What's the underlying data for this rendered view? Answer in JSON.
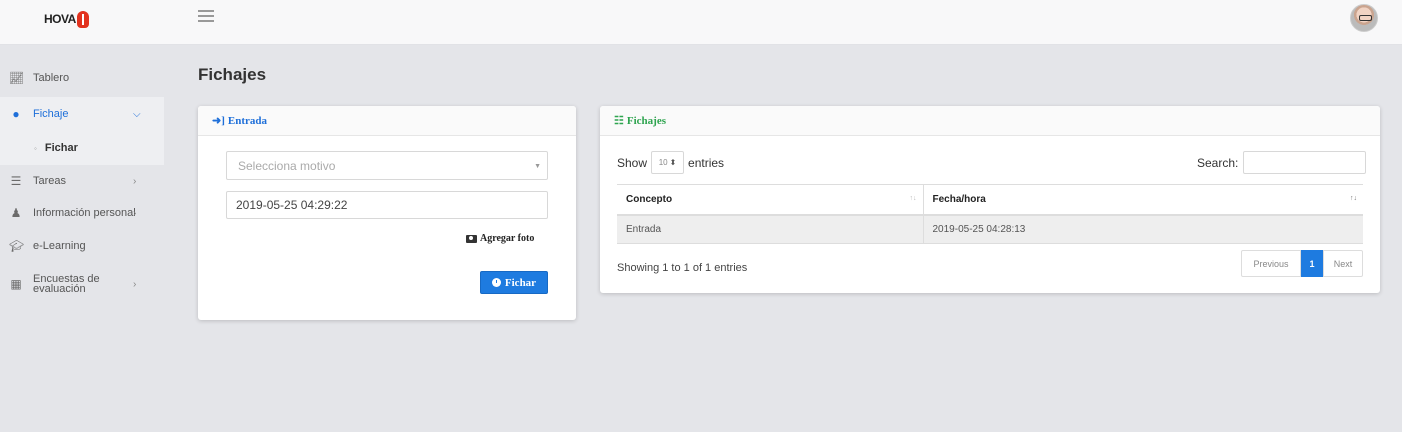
{
  "header": {
    "logo_text": "HOVA"
  },
  "sidebar": {
    "items": [
      {
        "label": "Tablero",
        "icon": "chart-line-icon"
      },
      {
        "label": "Fichaje",
        "icon": "clock-icon",
        "active": true
      },
      {
        "label": "Fichar",
        "sub": true
      },
      {
        "label": "Tareas",
        "icon": "list-icon"
      },
      {
        "label": "Información personal",
        "icon": "person-icon"
      },
      {
        "label": "e-Learning",
        "icon": "graduation-cap-icon"
      },
      {
        "label": "Encuestas de evaluación",
        "icon": "bar-chart-icon"
      }
    ]
  },
  "page": {
    "title": "Fichajes"
  },
  "entrada": {
    "title": "Entrada",
    "motivo_placeholder": "Selecciona motivo",
    "datetime_value": "2019-05-25 04:29:22",
    "foto_label": "Agregar foto",
    "fichar_label": "Fichar"
  },
  "fichajes": {
    "title": "Fichajes",
    "show_label": "Show",
    "length_value": "10",
    "entries_label": "entries",
    "search_label": "Search:",
    "columns": [
      "Concepto",
      "Fecha/hora"
    ],
    "rows": [
      [
        "Entrada",
        "2019-05-25 04:28:13"
      ]
    ],
    "info": "Showing 1 to 1 of 1 entries",
    "pagination": {
      "previous": "Previous",
      "current": "1",
      "next": "Next"
    }
  },
  "colors": {
    "primary": "#1e7be0",
    "success": "#2ea44f",
    "background": "#e4e5e9"
  }
}
